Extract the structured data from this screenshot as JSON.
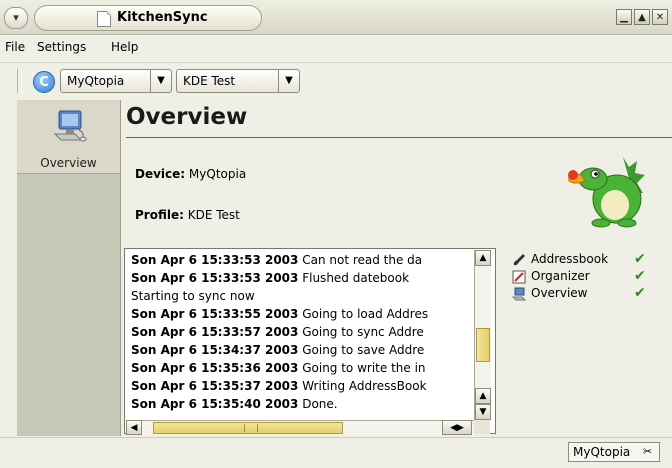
{
  "window": {
    "title": "KitchenSync",
    "menu_button_icon": "chevron-down-icon",
    "controls": [
      "minimize-icon",
      "maximize-icon",
      "close-icon"
    ]
  },
  "menubar": {
    "items": [
      {
        "label": "File"
      },
      {
        "label": "Settings"
      },
      {
        "label": "Help"
      }
    ]
  },
  "toolbar": {
    "sync_icon": "sync-icon",
    "device_combo": {
      "value": "MyQtopia"
    },
    "profile_combo": {
      "value": "KDE Test"
    }
  },
  "sidebar": {
    "items": [
      {
        "label": "Overview",
        "icon": "computer-icon"
      }
    ]
  },
  "main": {
    "title": "Overview",
    "device_label": "Device:",
    "device_value": "MyQtopia",
    "profile_label": "Profile:",
    "profile_value": "KDE Test"
  },
  "log": {
    "lines": [
      {
        "time": "Son Apr 6 15:33:53 2003",
        "msg": "Can not read the da"
      },
      {
        "time": "Son Apr 6 15:33:53 2003",
        "msg": "Flushed datebook"
      },
      {
        "time": "",
        "msg": "Starting to sync now"
      },
      {
        "time": "Son Apr 6 15:33:55 2003",
        "msg": "Going to load Addres"
      },
      {
        "time": "Son Apr 6 15:33:57 2003",
        "msg": "Going to sync Addre"
      },
      {
        "time": "Son Apr 6 15:34:37 2003",
        "msg": "Going to save Addre"
      },
      {
        "time": "Son Apr 6 15:35:36 2003",
        "msg": "Going to write the in"
      },
      {
        "time": "Son Apr 6 15:35:37 2003",
        "msg": "Writing AddressBook"
      },
      {
        "time": "Son Apr 6 15:35:40 2003",
        "msg": "Done."
      }
    ],
    "vertical_scroll_position": 0.7,
    "horizontal_scroll_position": 0.1
  },
  "parts": [
    {
      "label": "Addressbook",
      "icon": "addressbook-icon",
      "status": "✔",
      "status_color": "#2e8b1e"
    },
    {
      "label": "Organizer",
      "icon": "organizer-icon",
      "status": "✔",
      "status_color": "#2e8b1e"
    },
    {
      "label": "Overview",
      "icon": "overview-icon",
      "status": "✔",
      "status_color": "#2e8b1e"
    }
  ],
  "statusbar": {
    "device": "MyQtopia",
    "icon": "connection-icon"
  },
  "colors": {
    "window_bg": "#efefe5",
    "sidebar_bg": "#c7c7b8",
    "scroll_thumb": "#e6cf68",
    "check": "#2e8b1e"
  }
}
